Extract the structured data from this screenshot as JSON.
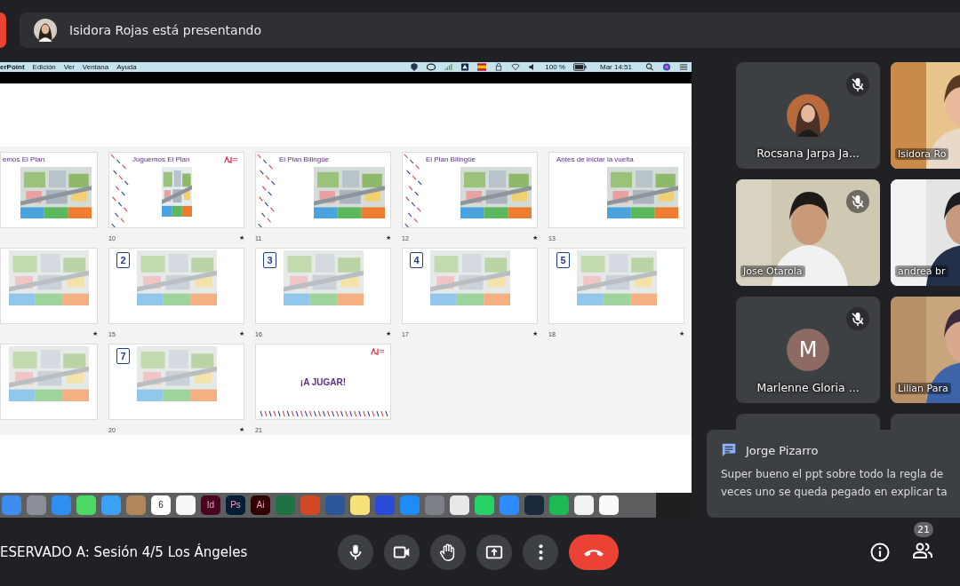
{
  "presenter_bar": {
    "text": "Isidora Rojas está presentando"
  },
  "shared_screen": {
    "menu_bar": {
      "items": [
        "erPoint",
        "Edición",
        "Ver",
        "Ventana",
        "Ayuda"
      ],
      "battery": "100 %",
      "clock": "Mar 14:51"
    },
    "slides": [
      {
        "kind": "board",
        "title": "emos El Plan",
        "stripes": false
      },
      {
        "kind": "card",
        "title": "Juguemos El Plan",
        "number": "10",
        "mark": "★",
        "stripes": true
      },
      {
        "kind": "board",
        "title": "El Plan Bilingüe",
        "number": "11",
        "mark": "★",
        "stripes": true
      },
      {
        "kind": "board",
        "title": "El Plan Bilingüe",
        "number": "12",
        "mark": "★",
        "stripes": true
      },
      {
        "kind": "board",
        "title": "Antes de iniciar la vuelta",
        "number": "13",
        "stripes": false
      },
      {
        "kind": "step",
        "mark": "★",
        "stripes": false
      },
      {
        "kind": "step",
        "step": "2",
        "number": "15",
        "mark": "★",
        "stripes": false
      },
      {
        "kind": "step",
        "step": "3",
        "number": "16",
        "mark": "★",
        "stripes": false
      },
      {
        "kind": "step",
        "step": "4",
        "number": "17",
        "mark": "★",
        "stripes": false
      },
      {
        "kind": "step",
        "step": "5",
        "number": "18",
        "mark": "★",
        "stripes": false
      },
      {
        "kind": "step",
        "stripes": false
      },
      {
        "kind": "step",
        "step": "7",
        "number": "20",
        "mark": "★",
        "stripes": false
      },
      {
        "kind": "end",
        "title": "¡A JUGAR!",
        "number": "21",
        "stripes": true
      }
    ],
    "dock": [
      {
        "color": "#3d8ef0"
      },
      {
        "color": "#8a8f98"
      },
      {
        "color": "#2f8ff0"
      },
      {
        "color": "#4cd964"
      },
      {
        "color": "#3aa1f5"
      },
      {
        "color": "#b0875a"
      },
      {
        "color": "#ffffff",
        "label": "6"
      },
      {
        "color": "#f7f7f7"
      },
      {
        "color": "#49021f",
        "label": "Id"
      },
      {
        "color": "#001e36",
        "label": "Ps"
      },
      {
        "color": "#330000",
        "label": "Ai"
      },
      {
        "color": "#1f7244"
      },
      {
        "color": "#d24726"
      },
      {
        "color": "#2b579a"
      },
      {
        "color": "#f7e27a"
      },
      {
        "color": "#2a4bd8"
      },
      {
        "color": "#1d8cf8"
      },
      {
        "color": "#7d8086"
      },
      {
        "color": "#e8e8e8"
      },
      {
        "color": "#25d366"
      },
      {
        "color": "#2d8cff"
      },
      {
        "color": "#1b2a3a"
      },
      {
        "color": "#1db954"
      },
      {
        "color": "#f2f2f2"
      },
      {
        "color": "#fafafa"
      }
    ]
  },
  "participants": [
    {
      "name": "Rocsana Jarpa Ja...",
      "muted": true
    },
    {
      "kind": "video",
      "name": "Isidora Ro",
      "muted": false
    },
    {
      "kind": "video",
      "name": "Jose Otarola",
      "muted": true
    },
    {
      "kind": "video",
      "name": "andrea br",
      "muted": false
    },
    {
      "kind": "letter",
      "initial": "M",
      "name": "Marlenne Gloria ...",
      "muted": true
    },
    {
      "kind": "video",
      "name": "Lilian Para",
      "muted": false
    },
    {
      "kind": "covered"
    },
    {
      "kind": "covered"
    }
  ],
  "chat_notification": {
    "sender": "Jorge Pizarro",
    "lines": [
      "Super bueno el ppt sobre todo la regla de",
      "veces uno se queda pegado en explicar ta"
    ]
  },
  "meeting_title": "ESERVADO A: Sesión 4/5 Los Ángeles",
  "controls": [
    {
      "kind": "mic"
    },
    {
      "kind": "camera"
    },
    {
      "kind": "hand"
    },
    {
      "kind": "present"
    },
    {
      "kind": "more"
    },
    {
      "kind": "end"
    }
  ],
  "people_count": "21"
}
